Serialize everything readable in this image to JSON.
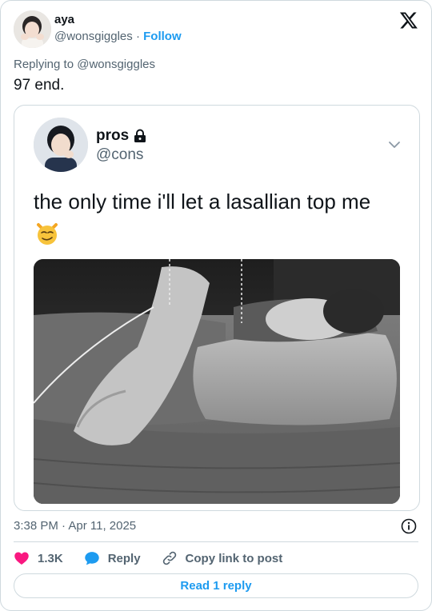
{
  "tweet": {
    "author_name": "aya",
    "author_handle": "@wonsgiggles",
    "separator": "·",
    "follow_label": "Follow",
    "replying_to": "Replying to @wonsgiggles",
    "text": "97 end.",
    "timestamp": "3:38 PM · Apr 11, 2025"
  },
  "quoted_tweet": {
    "name": "pros",
    "handle": "@cons",
    "text": "the only time i'll let a lasallian top me",
    "emoji": "😼"
  },
  "actions": {
    "likes": "1.3K",
    "reply_label": "Reply",
    "copy_link_label": "Copy link to post",
    "read_reply_label": "Read 1 reply"
  },
  "colors": {
    "accent": "#1d9bf0",
    "like": "#f91880",
    "secondary_text": "#536471",
    "border": "#cfd9de"
  },
  "icons": [
    "x-logo-icon",
    "lock-icon",
    "chevron-down-icon",
    "info-icon",
    "heart-icon",
    "reply-bubble-icon",
    "link-icon"
  ]
}
